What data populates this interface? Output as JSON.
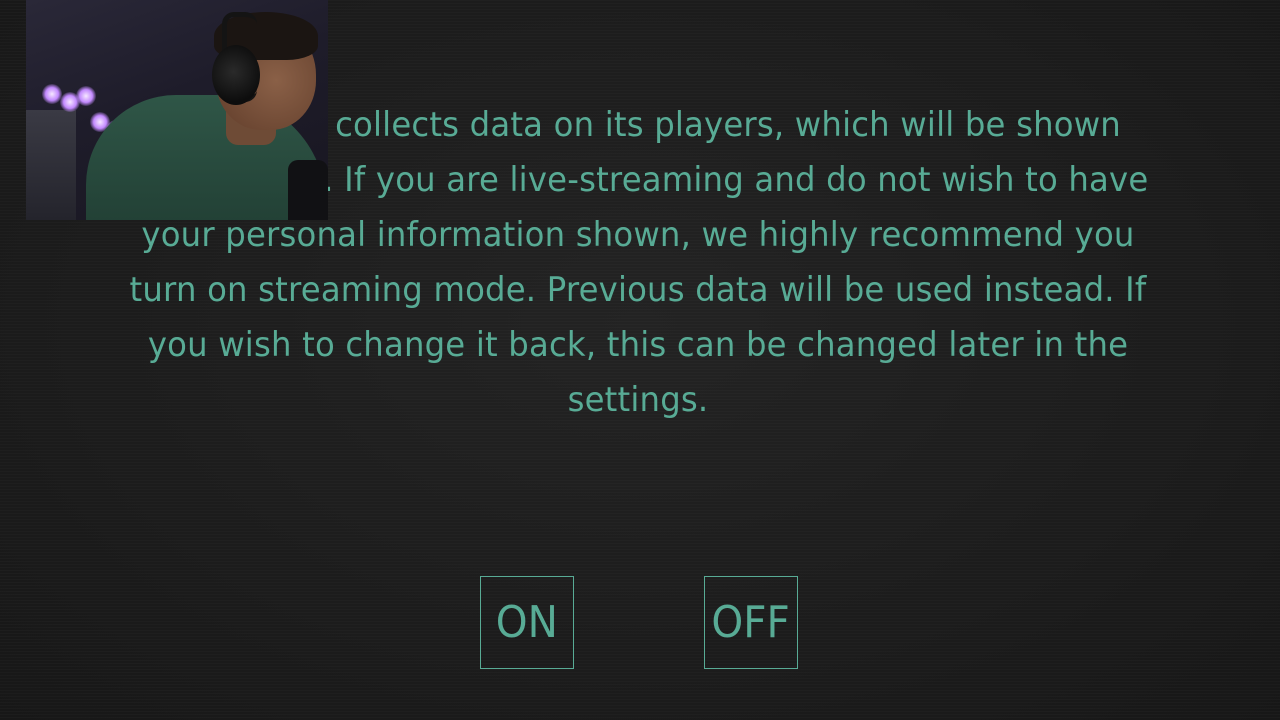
{
  "notice": {
    "text": "This game collects data on its players, which will be shown occasionally. If you are live-streaming and do not wish to have your personal information shown, we highly recommend you turn on streaming mode. Previous data will be used instead. If you wish to change it back, this can be changed later in the settings."
  },
  "options": {
    "on_label": "ON",
    "off_label": "OFF"
  },
  "colors": {
    "text": "#58ab95",
    "background": "#1d1d1d"
  }
}
